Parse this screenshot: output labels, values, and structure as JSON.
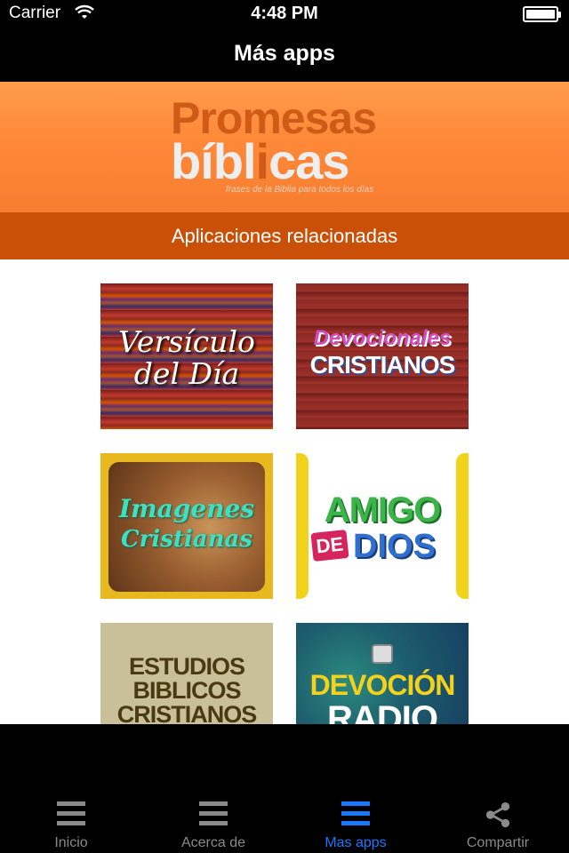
{
  "status_bar": {
    "carrier": "Carrier",
    "time": "4:48 PM"
  },
  "nav": {
    "title": "Más apps"
  },
  "banner": {
    "logo_line1": "Promesas",
    "logo_line2_a": "bíbl",
    "logo_line2_b": "i",
    "logo_line2_c": "cas",
    "tagline": "frases de la Biblia para todos los días",
    "subtitle": "Aplicaciones relacionadas"
  },
  "apps": {
    "versiculo": {
      "line1": "Versículo",
      "line2": "del Día"
    },
    "devocionales": {
      "line1": "Devocionales",
      "line2": "CRISTIANOS"
    },
    "imagenes": {
      "line1": "Imagenes",
      "line2": "Cristianas"
    },
    "amigo": {
      "line1": "AMIGO",
      "de": "DE",
      "line2": "DIOS"
    },
    "estudios": {
      "line1": "ESTUDIOS",
      "line2": "BIBLICOS",
      "line3": "CRISTIANOS"
    },
    "radio": {
      "line1": "DEVOCIÓN",
      "line2": "RADIO"
    }
  },
  "tabs": [
    {
      "label": "Inicio",
      "icon": "menu-icon"
    },
    {
      "label": "Acerca de",
      "icon": "menu-icon"
    },
    {
      "label": "Mas apps",
      "icon": "menu-icon",
      "active": true
    },
    {
      "label": "Compartir",
      "icon": "share-icon"
    }
  ],
  "colors": {
    "banner_orange": "#ff8a3a",
    "subtitle_bar": "#c95006",
    "active_tab": "#1a78ff",
    "inactive_tab": "#8a8a8a"
  }
}
